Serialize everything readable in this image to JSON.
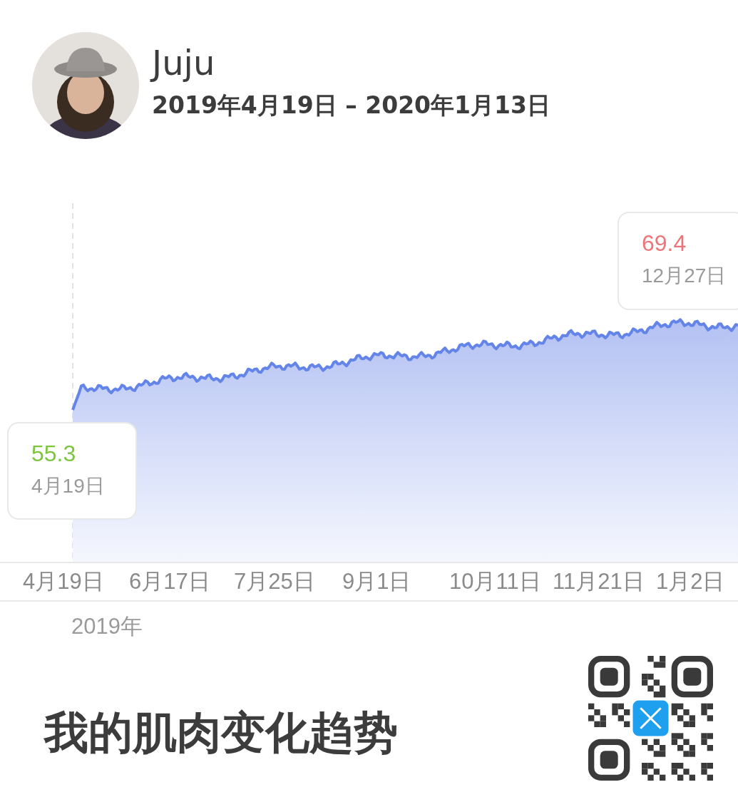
{
  "profile": {
    "name": "Juju",
    "date_range": "2019年4月19日 – 2020年1月13日"
  },
  "chart": {
    "callouts": [
      {
        "kind": "start",
        "value": "55.3",
        "date": "4月19日"
      },
      {
        "kind": "peak",
        "value": "69.4",
        "date": "12月27日"
      }
    ],
    "x_labels": [
      "4月19日",
      "6月17日",
      "7月25日",
      "9月1日",
      "10月11日",
      "11月21日",
      "1月2日"
    ],
    "year": "2019年"
  },
  "title": "我的肌肉变化趋势"
}
